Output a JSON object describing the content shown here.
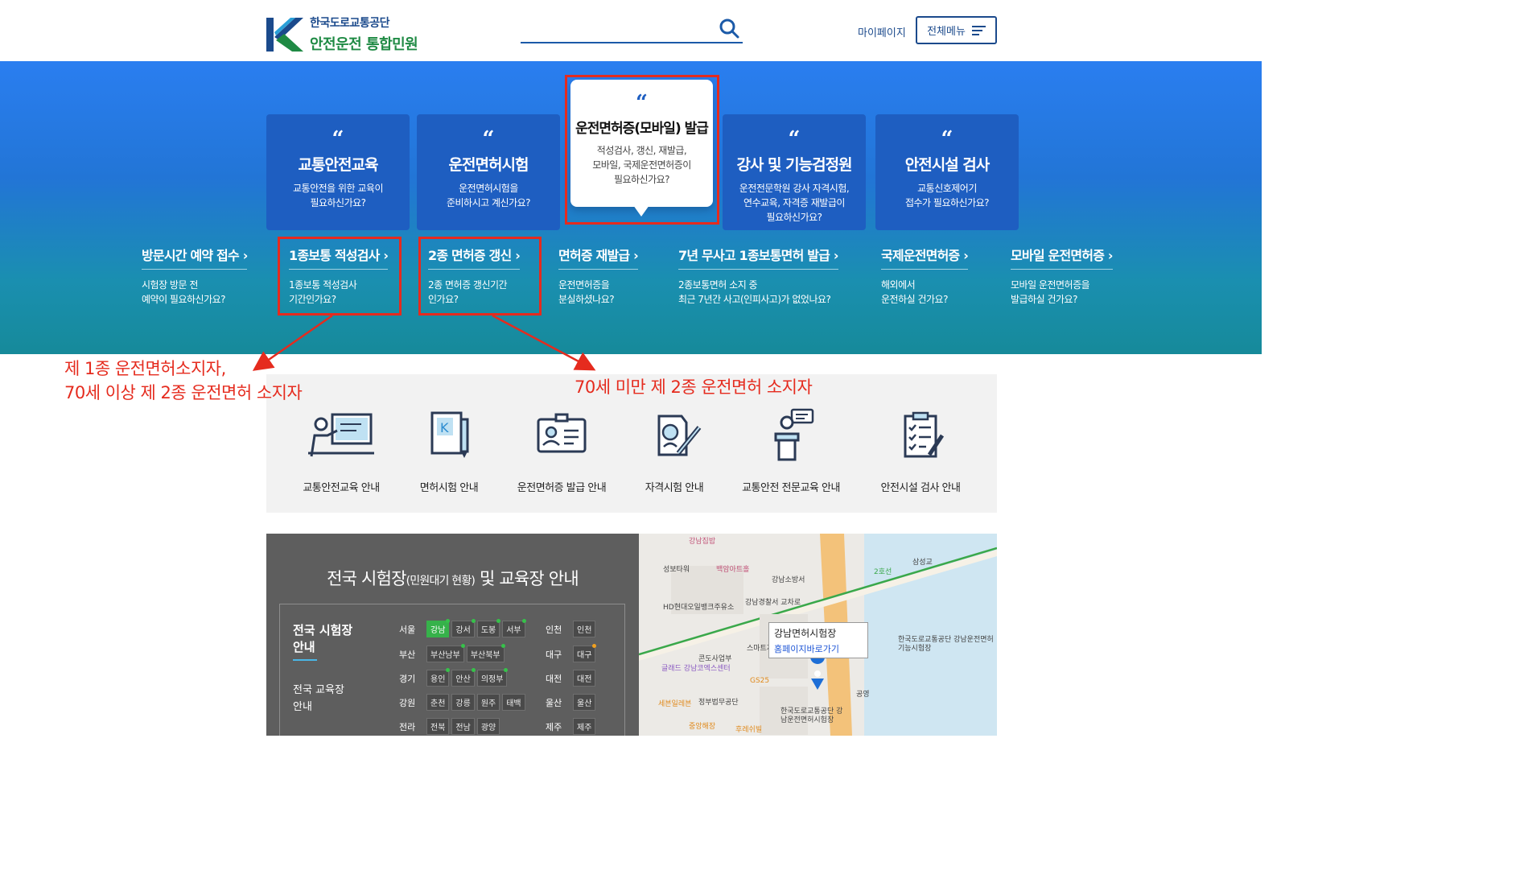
{
  "header": {
    "logo_line1": "한국도로교통공단",
    "logo_line2": "안전운전 통합민원",
    "search_placeholder": "",
    "mypage_label": "마이페이지",
    "allmenu_label": "전체메뉴"
  },
  "cards": [
    {
      "title": "교통안전교육",
      "desc1": "교통안전을 위한 교육이",
      "desc2": "필요하신가요?",
      "desc3": ""
    },
    {
      "title": "운전면허시험",
      "desc1": "운전면허시험을",
      "desc2": "준비하시고 계신가요?",
      "desc3": ""
    },
    {
      "title": "운전면허증(모바일) 발급",
      "desc1": "적성검사, 갱신, 재발급,",
      "desc2": "모바일, 국제운전면허증이",
      "desc3": "필요하신가요?"
    },
    {
      "title": "강사 및 기능검정원",
      "desc1": "운전전문학원 강사 자격시험,",
      "desc2": "연수교육, 자격증 재발급이",
      "desc3": "필요하신가요?"
    },
    {
      "title": "안전시설 검사",
      "desc1": "교통신호제어기",
      "desc2": "접수가 필요하신가요?",
      "desc3": ""
    }
  ],
  "quick_links": [
    {
      "title": "방문시간 예약 접수",
      "desc1": "시험장 방문 전",
      "desc2": "예약이 필요하신가요?"
    },
    {
      "title": "1종보통 적성검사",
      "desc1": "1종보통 적성검사",
      "desc2": "기간인가요?"
    },
    {
      "title": "2종 면허증 갱신",
      "desc1": "2종 면허증 갱신기간",
      "desc2": "인가요?"
    },
    {
      "title": "면허증 재발급",
      "desc1": "운전면허증을",
      "desc2": "분실하셨나요?"
    },
    {
      "title": "7년 무사고 1종보통면허 발급",
      "desc1": "2종보통면허 소지 중",
      "desc2": "최근 7년간 사고(인피사고)가 없었나요?"
    },
    {
      "title": "국제운전면허증",
      "desc1": "해외에서",
      "desc2": "운전하실 건가요?"
    },
    {
      "title": "모바일 운전면허증",
      "desc1": "모바일 운전면허증을",
      "desc2": "발급하실 건가요?"
    }
  ],
  "annotations": {
    "left_line1": "제 1종 운전면허소지자,",
    "left_line2": "70세 이상 제 2종 운전면허 소지자",
    "right_line1": "70세 미만 제 2종 운전면허 소지자"
  },
  "info_items": [
    {
      "label": "교통안전교육 안내",
      "icon": "lecture-icon"
    },
    {
      "label": "면허시험 안내",
      "icon": "license-book-icon"
    },
    {
      "label": "운전면허증 발급 안내",
      "icon": "id-card-icon"
    },
    {
      "label": "자격시험 안내",
      "icon": "exam-pen-icon"
    },
    {
      "label": "교통안전 전문교육 안내",
      "icon": "podium-icon"
    },
    {
      "label": "안전시설 검사 안내",
      "icon": "clipboard-check-icon"
    }
  ],
  "centers": {
    "title_main": "전국 시험장",
    "title_small": "(민원대기 현황)",
    "title_end": " 및 교육장 안내",
    "side1_line1": "전국 시험장",
    "side1_line2": "안내",
    "side2_line1": "전국 교육장",
    "side2_line2": "안내",
    "rows": [
      {
        "region": "서울",
        "tags": [
          "강남",
          "강서",
          "도봉",
          "서부"
        ]
      },
      {
        "region": "부산",
        "tags": [
          "부산남부",
          "부산북부"
        ]
      },
      {
        "region": "경기",
        "tags": [
          "용인",
          "안산",
          "의정부"
        ]
      },
      {
        "region": "강원",
        "tags": [
          "춘천",
          "강릉",
          "원주",
          "태백"
        ]
      },
      {
        "region": "전라",
        "tags": [
          "전북",
          "전남",
          "광양"
        ]
      }
    ],
    "rows_right": [
      {
        "region": "인천",
        "tags": [
          "인천"
        ]
      },
      {
        "region": "대구",
        "tags": [
          "대구"
        ]
      },
      {
        "region": "대전",
        "tags": [
          "대전"
        ]
      },
      {
        "region": "울산",
        "tags": [
          "울산"
        ]
      },
      {
        "region": "제주",
        "tags": [
          "제주"
        ]
      }
    ]
  },
  "map": {
    "popup_title": "강남면허시험장",
    "popup_link": "홈페이지바로가기",
    "labels": [
      "강남집밥",
      "성보타워",
      "백암아트홀",
      "강남소방서",
      "HD현대오일뱅크주유소",
      "강남경찰서 교차로",
      "스마트저축은",
      "콘도사업부",
      "글래드 강남코엑스센터",
      "GS25",
      "세븐일레븐",
      "정부법무공단",
      "중앙해장",
      "한국도로교통공단 강남운전면허시험장",
      "한국도로교통공단 강남운전면허 기능시험장",
      "삼성교",
      "2호선",
      "공영",
      "후레쉬빌"
    ]
  }
}
